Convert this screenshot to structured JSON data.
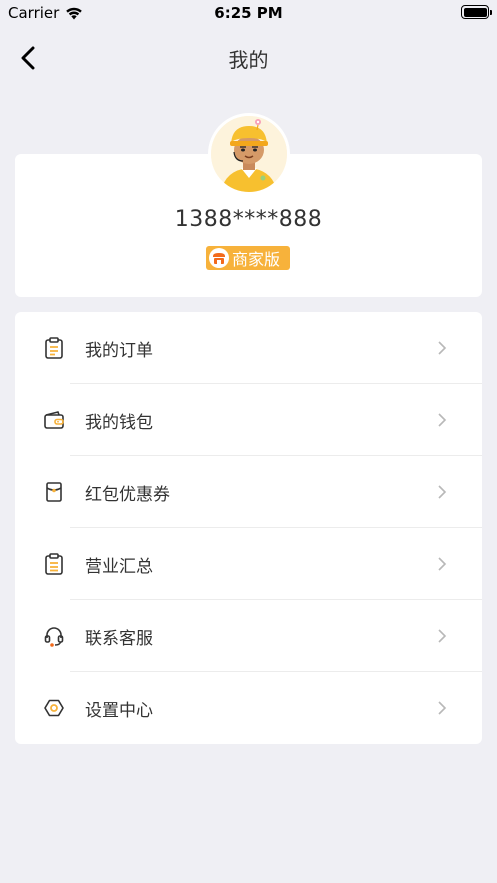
{
  "status_bar": {
    "carrier": "Carrier",
    "time": "6:25 PM"
  },
  "nav": {
    "title": "我的",
    "back_icon": "chevron-left-icon"
  },
  "profile": {
    "phone": "1388****888",
    "badge": "商家版"
  },
  "menu": {
    "items": [
      {
        "label": "我的订单",
        "icon": "clipboard-icon"
      },
      {
        "label": "我的钱包",
        "icon": "wallet-icon"
      },
      {
        "label": "红包优惠券",
        "icon": "red-envelope-icon"
      },
      {
        "label": "营业汇总",
        "icon": "report-icon"
      },
      {
        "label": "联系客服",
        "icon": "headset-icon"
      },
      {
        "label": "设置中心",
        "icon": "settings-icon"
      }
    ]
  },
  "colors": {
    "accent": "#f7b23b",
    "icon_dark": "#333333",
    "background": "#efeff4"
  }
}
